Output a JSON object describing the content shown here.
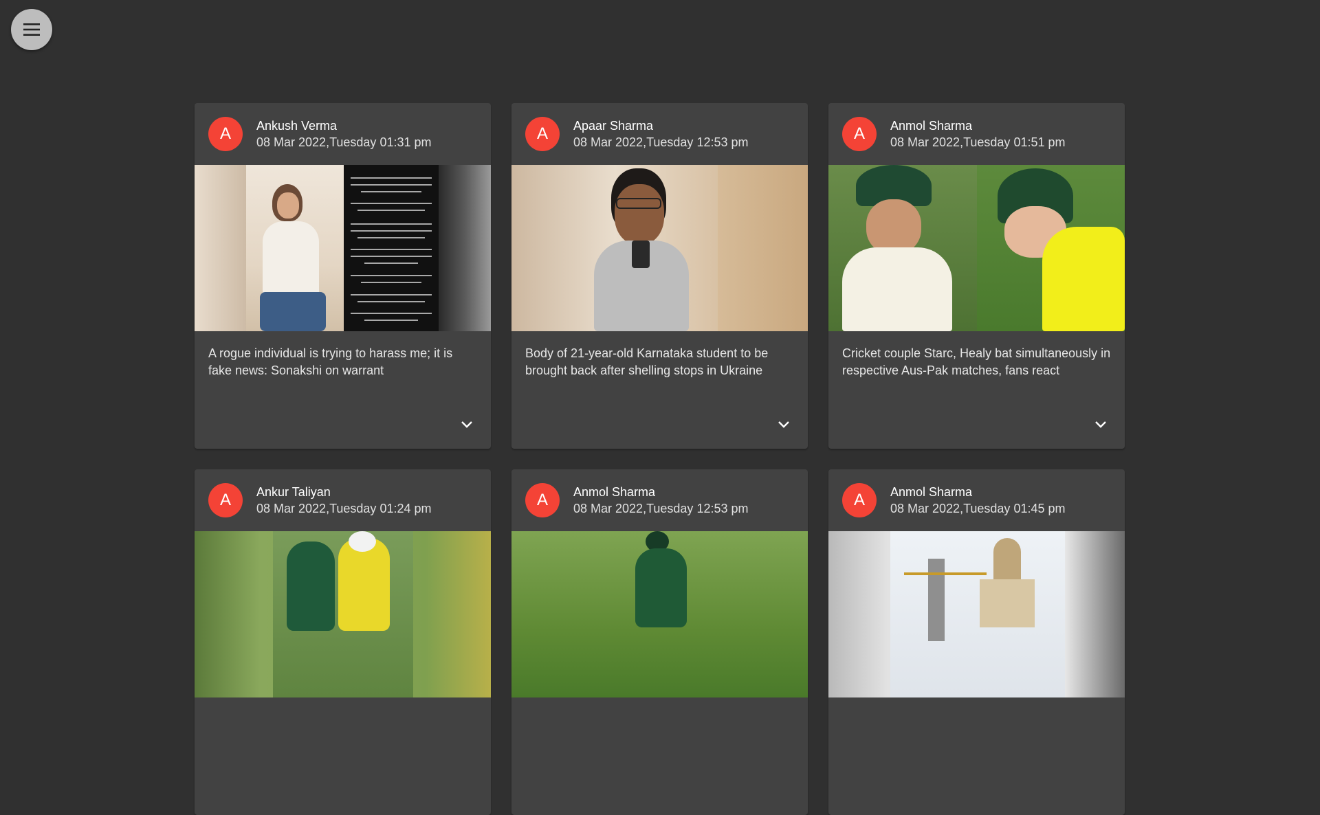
{
  "menu": {
    "icon": "hamburger-menu-icon"
  },
  "cards": [
    {
      "avatar_letter": "A",
      "author": "Ankush Verma",
      "date": "08 Mar 2022,Tuesday 01:31 pm",
      "headline": "A rogue individual is trying to harass me; it is fake news: Sonakshi on warrant",
      "expand_icon": "chevron-down-icon"
    },
    {
      "avatar_letter": "A",
      "author": "Apaar Sharma",
      "date": "08 Mar 2022,Tuesday 12:53 pm",
      "headline": "Body of 21-year-old Karnataka student to be brought back after shelling stops in Ukraine",
      "expand_icon": "chevron-down-icon"
    },
    {
      "avatar_letter": "A",
      "author": "Anmol Sharma",
      "date": "08 Mar 2022,Tuesday 01:51 pm",
      "headline": "Cricket couple Starc, Healy bat simultaneously in respective Aus-Pak matches, fans react",
      "expand_icon": "chevron-down-icon"
    },
    {
      "avatar_letter": "A",
      "author": "Ankur Taliyan",
      "date": "08 Mar 2022,Tuesday 01:24 pm",
      "headline": "",
      "expand_icon": "chevron-down-icon"
    },
    {
      "avatar_letter": "A",
      "author": "Anmol Sharma",
      "date": "08 Mar 2022,Tuesday 12:53 pm",
      "headline": "",
      "expand_icon": "chevron-down-icon"
    },
    {
      "avatar_letter": "A",
      "author": "Anmol Sharma",
      "date": "08 Mar 2022,Tuesday 01:45 pm",
      "headline": "",
      "expand_icon": "chevron-down-icon"
    }
  ],
  "colors": {
    "background": "#303030",
    "card": "#424242",
    "avatar": "#f44336",
    "menu_button": "#bdbdbd"
  }
}
